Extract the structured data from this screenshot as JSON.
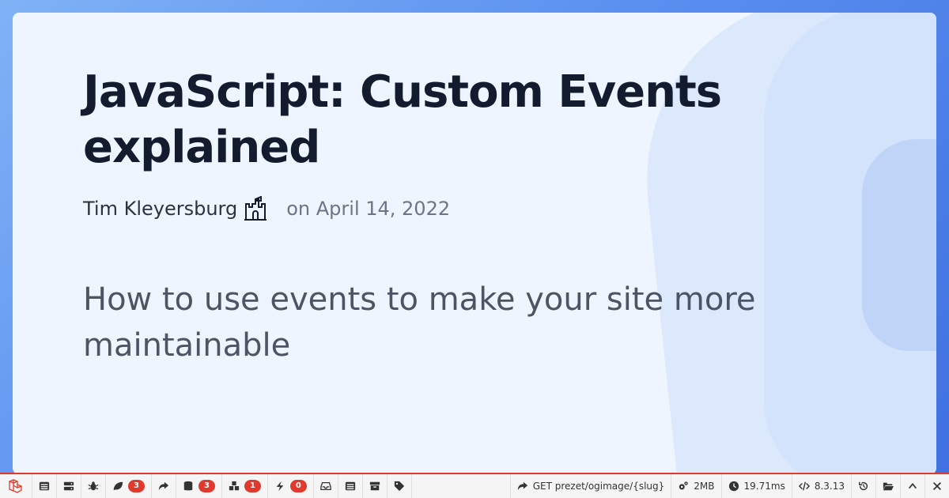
{
  "article": {
    "title": "JavaScript: Custom Events explained",
    "author": "Tim Kleyersburg",
    "date": "on April 14, 2022",
    "subtitle": "How to use events to make your site more maintainable"
  },
  "debugbar": {
    "accent_color": "#e03a2f",
    "tabs": [
      {
        "icon": "list-icon",
        "badge": ""
      },
      {
        "icon": "server-icon",
        "badge": ""
      },
      {
        "icon": "bug-icon",
        "badge": ""
      },
      {
        "icon": "leaf-icon",
        "badge": "3"
      },
      {
        "icon": "share-icon",
        "badge": ""
      },
      {
        "icon": "database-icon",
        "badge": "3"
      },
      {
        "icon": "cubes-icon",
        "badge": "1"
      },
      {
        "icon": "bolt-icon",
        "badge": "0"
      },
      {
        "icon": "inbox-icon",
        "badge": ""
      },
      {
        "icon": "table-icon",
        "badge": ""
      },
      {
        "icon": "archive-icon",
        "badge": ""
      },
      {
        "icon": "tags-icon",
        "badge": ""
      }
    ],
    "request": "GET prezet/ogimage/{slug}",
    "memory": "2MB",
    "time": "19.71ms",
    "php_version": "8.3.13"
  }
}
